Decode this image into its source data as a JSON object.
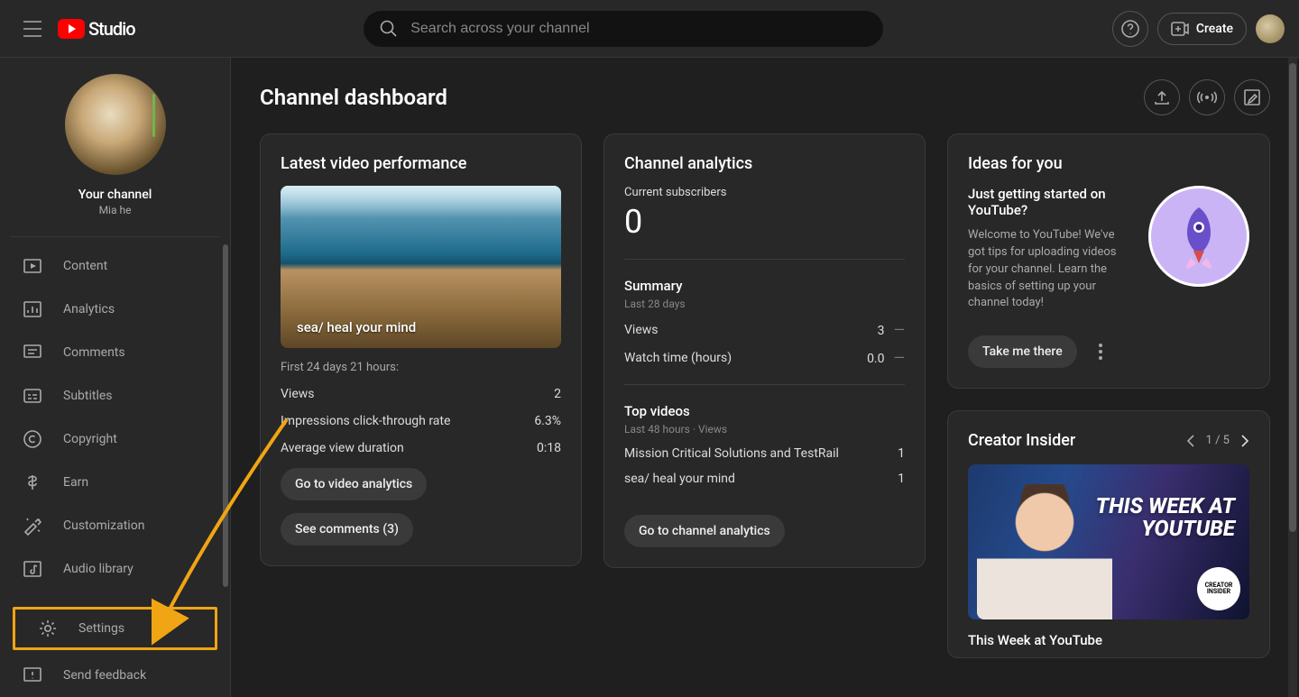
{
  "header": {
    "logo_text": "Studio",
    "search_placeholder": "Search across your channel",
    "create_label": "Create"
  },
  "sidebar": {
    "your_channel_label": "Your channel",
    "channel_name": "Mia he",
    "nav": [
      {
        "label": "Content"
      },
      {
        "label": "Analytics"
      },
      {
        "label": "Comments"
      },
      {
        "label": "Subtitles"
      },
      {
        "label": "Copyright"
      },
      {
        "label": "Earn"
      },
      {
        "label": "Customization"
      },
      {
        "label": "Audio library"
      }
    ],
    "settings_label": "Settings",
    "feedback_label": "Send feedback"
  },
  "main": {
    "title": "Channel dashboard",
    "latest": {
      "heading": "Latest video performance",
      "video_title": "sea/ heal your mind",
      "period": "First 24 days 21 hours:",
      "rows": [
        {
          "label": "Views",
          "value": "2"
        },
        {
          "label": "Impressions click-through rate",
          "value": "6.3%"
        },
        {
          "label": "Average view duration",
          "value": "0:18"
        }
      ],
      "btn_analytics": "Go to video analytics",
      "btn_comments": "See comments (3)"
    },
    "analytics": {
      "heading": "Channel analytics",
      "current_sub_label": "Current subscribers",
      "current_sub_value": "0",
      "summary_title": "Summary",
      "summary_period": "Last 28 days",
      "summary_rows": [
        {
          "label": "Views",
          "value": "3"
        },
        {
          "label": "Watch time (hours)",
          "value": "0.0"
        }
      ],
      "top_title": "Top videos",
      "top_period": "Last 48 hours · Views",
      "top_rows": [
        {
          "label": "Mission Critical Solutions and TestRail",
          "value": "1"
        },
        {
          "label": "sea/ heal your mind",
          "value": "1"
        }
      ],
      "btn": "Go to channel analytics"
    },
    "ideas": {
      "heading": "Ideas for you",
      "title": "Just getting started on YouTube?",
      "body": "Welcome to YouTube! We've got tips for uploading videos for your channel. Learn the basics of setting up your channel today!",
      "btn": "Take me there"
    },
    "insider": {
      "heading": "Creator Insider",
      "pager": "1 / 5",
      "thumb_line1": "THIS WEEK AT",
      "thumb_line2": "YOUTUBE",
      "badge": "CREATOR INSIDER",
      "caption": "This Week at YouTube"
    }
  }
}
